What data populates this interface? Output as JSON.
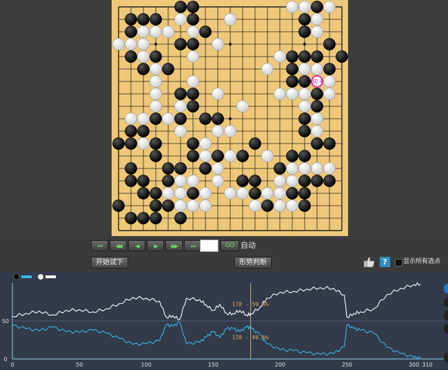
{
  "board": {
    "size": 19,
    "stones": [
      [
        5,
        0,
        "b"
      ],
      [
        6,
        0,
        "b"
      ],
      [
        14,
        0,
        "w"
      ],
      [
        15,
        0,
        "w"
      ],
      [
        16,
        0,
        "b"
      ],
      [
        17,
        0,
        "w"
      ],
      [
        1,
        1,
        "b"
      ],
      [
        2,
        1,
        "b"
      ],
      [
        3,
        1,
        "b"
      ],
      [
        5,
        1,
        "w"
      ],
      [
        6,
        1,
        "b"
      ],
      [
        9,
        1,
        "w"
      ],
      [
        15,
        1,
        "b"
      ],
      [
        16,
        1,
        "w"
      ],
      [
        1,
        2,
        "b"
      ],
      [
        2,
        2,
        "w"
      ],
      [
        3,
        2,
        "w"
      ],
      [
        4,
        2,
        "w"
      ],
      [
        6,
        2,
        "w"
      ],
      [
        7,
        2,
        "b"
      ],
      [
        15,
        2,
        "b"
      ],
      [
        16,
        2,
        "w"
      ],
      [
        0,
        3,
        "w"
      ],
      [
        1,
        3,
        "w"
      ],
      [
        2,
        3,
        "w"
      ],
      [
        5,
        3,
        "b"
      ],
      [
        6,
        3,
        "b"
      ],
      [
        8,
        3,
        "w"
      ],
      [
        17,
        3,
        "b"
      ],
      [
        1,
        4,
        "b"
      ],
      [
        2,
        4,
        "w"
      ],
      [
        3,
        4,
        "b"
      ],
      [
        6,
        4,
        "w"
      ],
      [
        13,
        4,
        "w"
      ],
      [
        14,
        4,
        "b"
      ],
      [
        15,
        4,
        "b"
      ],
      [
        16,
        4,
        "b"
      ],
      [
        18,
        4,
        "b"
      ],
      [
        2,
        5,
        "b"
      ],
      [
        3,
        5,
        "w"
      ],
      [
        4,
        5,
        "b"
      ],
      [
        12,
        5,
        "w"
      ],
      [
        14,
        5,
        "b"
      ],
      [
        15,
        5,
        "w"
      ],
      [
        16,
        5,
        "w"
      ],
      [
        17,
        5,
        "b"
      ],
      [
        3,
        6,
        "w"
      ],
      [
        6,
        6,
        "w"
      ],
      [
        14,
        6,
        "b"
      ],
      [
        15,
        6,
        "b"
      ],
      [
        16,
        6,
        "w"
      ],
      [
        17,
        6,
        "w"
      ],
      [
        3,
        7,
        "w"
      ],
      [
        5,
        7,
        "b"
      ],
      [
        6,
        7,
        "b"
      ],
      [
        8,
        7,
        "w"
      ],
      [
        13,
        7,
        "w"
      ],
      [
        14,
        7,
        "w"
      ],
      [
        15,
        7,
        "w"
      ],
      [
        16,
        7,
        "b"
      ],
      [
        17,
        7,
        "w"
      ],
      [
        3,
        8,
        "w"
      ],
      [
        5,
        8,
        "w"
      ],
      [
        6,
        8,
        "b"
      ],
      [
        10,
        8,
        "w"
      ],
      [
        15,
        8,
        "w"
      ],
      [
        16,
        8,
        "b"
      ],
      [
        1,
        9,
        "w"
      ],
      [
        2,
        9,
        "w"
      ],
      [
        3,
        9,
        "b"
      ],
      [
        4,
        9,
        "w"
      ],
      [
        5,
        9,
        "b"
      ],
      [
        7,
        9,
        "b"
      ],
      [
        8,
        9,
        "b"
      ],
      [
        15,
        9,
        "b"
      ],
      [
        16,
        9,
        "w"
      ],
      [
        1,
        10,
        "b"
      ],
      [
        2,
        10,
        "b"
      ],
      [
        5,
        10,
        "w"
      ],
      [
        8,
        10,
        "w"
      ],
      [
        9,
        10,
        "w"
      ],
      [
        15,
        10,
        "b"
      ],
      [
        16,
        10,
        "w"
      ],
      [
        0,
        11,
        "b"
      ],
      [
        1,
        11,
        "b"
      ],
      [
        2,
        11,
        "w"
      ],
      [
        3,
        11,
        "b"
      ],
      [
        6,
        11,
        "b"
      ],
      [
        7,
        11,
        "w"
      ],
      [
        11,
        11,
        "b"
      ],
      [
        16,
        11,
        "b"
      ],
      [
        17,
        11,
        "b"
      ],
      [
        3,
        12,
        "b"
      ],
      [
        6,
        12,
        "b"
      ],
      [
        7,
        12,
        "w"
      ],
      [
        8,
        12,
        "b"
      ],
      [
        9,
        12,
        "w"
      ],
      [
        10,
        12,
        "b"
      ],
      [
        12,
        12,
        "w"
      ],
      [
        14,
        12,
        "b"
      ],
      [
        15,
        12,
        "b"
      ],
      [
        1,
        13,
        "b"
      ],
      [
        4,
        13,
        "b"
      ],
      [
        5,
        13,
        "b"
      ],
      [
        7,
        13,
        "b"
      ],
      [
        8,
        13,
        "w"
      ],
      [
        13,
        13,
        "b"
      ],
      [
        14,
        13,
        "w"
      ],
      [
        15,
        13,
        "w"
      ],
      [
        16,
        13,
        "w"
      ],
      [
        17,
        13,
        "w"
      ],
      [
        1,
        14,
        "b"
      ],
      [
        2,
        14,
        "b"
      ],
      [
        4,
        14,
        "b"
      ],
      [
        5,
        14,
        "w"
      ],
      [
        6,
        14,
        "w"
      ],
      [
        8,
        14,
        "w"
      ],
      [
        10,
        14,
        "b"
      ],
      [
        11,
        14,
        "b"
      ],
      [
        13,
        14,
        "w"
      ],
      [
        14,
        14,
        "w"
      ],
      [
        15,
        14,
        "b"
      ],
      [
        16,
        14,
        "b"
      ],
      [
        17,
        14,
        "b"
      ],
      [
        2,
        15,
        "b"
      ],
      [
        3,
        15,
        "b"
      ],
      [
        4,
        15,
        "w"
      ],
      [
        5,
        15,
        "w"
      ],
      [
        6,
        15,
        "b"
      ],
      [
        7,
        15,
        "w"
      ],
      [
        9,
        15,
        "w"
      ],
      [
        10,
        15,
        "w"
      ],
      [
        11,
        15,
        "b"
      ],
      [
        12,
        15,
        "w"
      ],
      [
        13,
        15,
        "w"
      ],
      [
        14,
        15,
        "b"
      ],
      [
        15,
        15,
        "b"
      ],
      [
        0,
        16,
        "b"
      ],
      [
        3,
        16,
        "b"
      ],
      [
        4,
        16,
        "b"
      ],
      [
        5,
        16,
        "w"
      ],
      [
        6,
        16,
        "w"
      ],
      [
        7,
        16,
        "w"
      ],
      [
        11,
        16,
        "w"
      ],
      [
        12,
        16,
        "b"
      ],
      [
        13,
        16,
        "w"
      ],
      [
        14,
        16,
        "w"
      ],
      [
        15,
        16,
        "b"
      ],
      [
        1,
        17,
        "b"
      ],
      [
        2,
        17,
        "b"
      ],
      [
        3,
        17,
        "b"
      ],
      [
        5,
        17,
        "b"
      ]
    ],
    "marker": {
      "col": 16,
      "row": 6,
      "label": "60.4"
    }
  },
  "nav": {
    "buttons": [
      {
        "id": "first",
        "label": "⏮"
      },
      {
        "id": "back10",
        "label": "◀◀"
      },
      {
        "id": "back1",
        "label": "◀"
      },
      {
        "id": "fwd1",
        "label": "▶"
      },
      {
        "id": "fwd10",
        "label": "▶▶"
      },
      {
        "id": "last",
        "label": "⏭"
      }
    ],
    "move_value": "",
    "go_label": "GO",
    "auto_label": "自动"
  },
  "toolbar": {
    "try_label": "开始试下",
    "judge_label": "形势判断",
    "show_all_label": "显示所有选点",
    "help_label": "?",
    "show_all_checked": false
  },
  "chart_data": {
    "type": "line",
    "xlim": [
      0,
      310
    ],
    "ylim": [
      0,
      100
    ],
    "x_ticks": [
      0,
      50,
      100,
      150,
      200,
      250,
      300,
      310
    ],
    "y_ticks": [
      0,
      50
    ],
    "current_move": 178,
    "annotations": [
      {
        "text": "178 - 59.4%",
        "series": "white"
      },
      {
        "text": "178 - 40.6%",
        "series": "black"
      }
    ],
    "series": [
      {
        "color": "#ffffff",
        "role": "white",
        "legend_swatch": "white-stone-icon",
        "x": [
          0,
          10,
          20,
          30,
          40,
          50,
          60,
          70,
          80,
          90,
          100,
          110,
          115,
          120,
          125,
          130,
          140,
          145,
          150,
          155,
          160,
          165,
          170,
          175,
          178,
          185,
          190,
          200,
          210,
          220,
          230,
          240,
          248,
          250,
          255,
          260,
          270,
          280,
          290,
          300,
          305
        ],
        "y": [
          56,
          60,
          63,
          58,
          64,
          65,
          62,
          66,
          73,
          81,
          80,
          76,
          55,
          57,
          52,
          80,
          78,
          71,
          64,
          72,
          60,
          60,
          64,
          58,
          59.4,
          68,
          80,
          88,
          89,
          92,
          94,
          93,
          84,
          55,
          60,
          62,
          66,
          85,
          93,
          98,
          99
        ]
      },
      {
        "color": "#3bb8ea",
        "role": "black",
        "legend_swatch": "black-stone-icon",
        "x": [
          0,
          10,
          20,
          30,
          40,
          50,
          60,
          70,
          80,
          90,
          100,
          110,
          115,
          120,
          125,
          130,
          140,
          145,
          150,
          155,
          160,
          165,
          170,
          175,
          178,
          185,
          190,
          200,
          210,
          220,
          230,
          240,
          248,
          250,
          255,
          260,
          270,
          280,
          290,
          300,
          305
        ],
        "y": [
          44,
          40,
          37,
          42,
          36,
          35,
          38,
          34,
          27,
          19,
          20,
          24,
          45,
          43,
          48,
          20,
          22,
          29,
          36,
          28,
          40,
          40,
          36,
          42,
          40.6,
          32,
          20,
          12,
          11,
          8,
          6,
          7,
          16,
          45,
          40,
          38,
          34,
          15,
          7,
          2,
          1
        ]
      }
    ]
  }
}
